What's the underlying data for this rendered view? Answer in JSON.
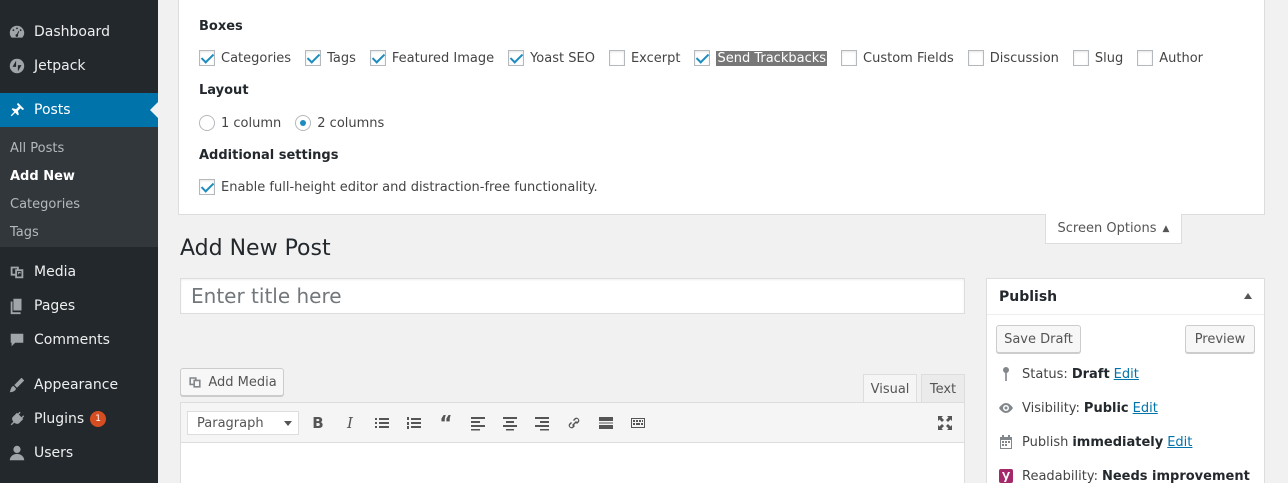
{
  "sidebar": {
    "items": [
      {
        "label": "Dashboard",
        "icon": "dashboard-icon"
      },
      {
        "label": "Jetpack",
        "icon": "jetpack-icon"
      },
      {
        "label": "Posts",
        "icon": "pin-icon"
      },
      {
        "label": "Media",
        "icon": "media-icon"
      },
      {
        "label": "Pages",
        "icon": "pages-icon"
      },
      {
        "label": "Comments",
        "icon": "comments-icon"
      },
      {
        "label": "Appearance",
        "icon": "appearance-icon"
      },
      {
        "label": "Plugins",
        "icon": "plugins-icon",
        "badge": "1"
      },
      {
        "label": "Users",
        "icon": "users-icon"
      }
    ],
    "submenu": [
      "All Posts",
      "Add New",
      "Categories",
      "Tags"
    ],
    "accent": "#0073aa",
    "background": "#23282d"
  },
  "screen_options": {
    "boxes_heading": "Boxes",
    "boxes": [
      {
        "label": "Categories",
        "checked": true
      },
      {
        "label": "Tags",
        "checked": true
      },
      {
        "label": "Featured Image",
        "checked": true
      },
      {
        "label": "Yoast SEO",
        "checked": true
      },
      {
        "label": "Excerpt",
        "checked": false
      },
      {
        "label": "Send Trackbacks",
        "checked": true
      },
      {
        "label": "Custom Fields",
        "checked": false
      },
      {
        "label": "Discussion",
        "checked": false
      },
      {
        "label": "Slug",
        "checked": false
      },
      {
        "label": "Author",
        "checked": false
      }
    ],
    "layout_heading": "Layout",
    "layout_options": [
      {
        "label": "1 column",
        "checked": false
      },
      {
        "label": "2 columns",
        "checked": true
      }
    ],
    "additional_heading": "Additional settings",
    "additional_option": "Enable full-height editor and distraction-free functionality.",
    "tab_label": "Screen Options"
  },
  "main": {
    "page_title": "Add New Post",
    "title_placeholder": "Enter title here",
    "add_media_label": "Add Media",
    "editor_tabs": {
      "visual": "Visual",
      "text": "Text"
    },
    "format_select": "Paragraph"
  },
  "publish": {
    "title": "Publish",
    "save_draft": "Save Draft",
    "preview": "Preview",
    "status_label": "Status:",
    "status_value": "Draft",
    "visibility_label": "Visibility:",
    "visibility_value": "Public",
    "schedule_label": "Publish",
    "schedule_value": "immediately",
    "readability_label": "Readability:",
    "readability_value": "Needs improvement",
    "edit_link": "Edit"
  }
}
